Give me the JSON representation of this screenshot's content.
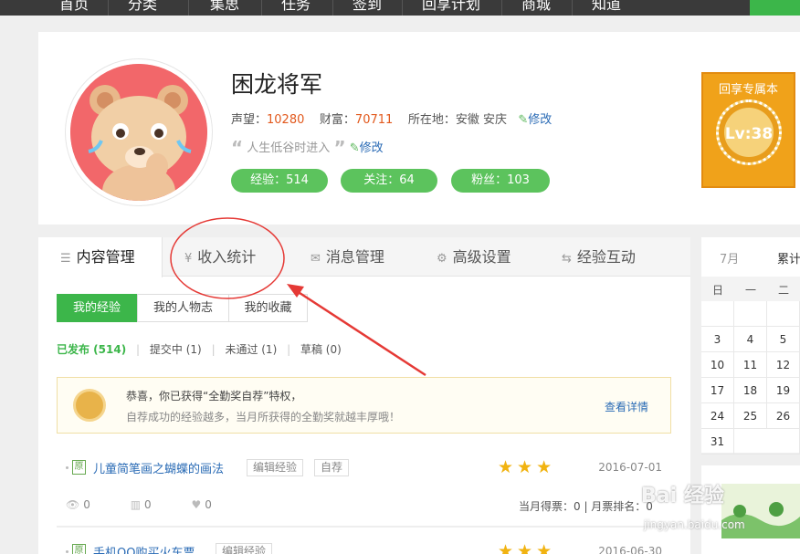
{
  "topnav": {
    "items": [
      "首页",
      "分类",
      "集思",
      "任务",
      "签到",
      "回享计划",
      "商城",
      "知道"
    ]
  },
  "profile": {
    "username": "困龙将军",
    "reputation_label": "声望：",
    "reputation": "10280",
    "wealth_label": "财富：",
    "wealth": "70711",
    "location_label": "所在地：",
    "location": "安徽 安庆",
    "edit_label": "修改",
    "motto": "人生低谷时进入",
    "motto_edit": "修改",
    "experience": "经验：514",
    "follow": "关注：64",
    "fans": "粉丝：103",
    "vip_title": "回享专属本",
    "vip_level": "Lv:38"
  },
  "tabs": [
    {
      "label": "内容管理",
      "icon": "list-icon"
    },
    {
      "label": "收入统计",
      "icon": "yen-icon"
    },
    {
      "label": "消息管理",
      "icon": "mail-icon"
    },
    {
      "label": "高级设置",
      "icon": "gear-icon"
    },
    {
      "label": "经验互动",
      "icon": "swap-icon"
    }
  ],
  "subtabs": [
    "我的经验",
    "我的人物志",
    "我的收藏"
  ],
  "filters": {
    "published": "已发布 (514)",
    "submitted": "提交中 (1)",
    "failed": "未通过 (1)",
    "draft": "草稿 (0)"
  },
  "notice": {
    "line1": "恭喜，你已获得“全勤奖自荐”特权，",
    "line2": "自荐成功的经验越多，当月所获得的全勤奖就越丰厚哦！",
    "link": "查看详情"
  },
  "articles": [
    {
      "badge": "原",
      "title": "儿童简笔画之蝴蝶的画法",
      "tags": [
        "编辑经验",
        "自荐"
      ],
      "stars": 3,
      "date": "2016-07-01",
      "views": "0",
      "votes": "0",
      "likes": "0",
      "monthly": "当月得票：0 | 月票排名：0"
    },
    {
      "badge": "原",
      "title": "手机QQ购买火车票",
      "tags": [
        "编辑经验"
      ],
      "stars": 3,
      "date": "2016-06-30"
    }
  ],
  "calendar": {
    "month": "7月",
    "side": "累计",
    "weekdays": [
      "日",
      "一",
      "二"
    ],
    "rows": [
      [
        "",
        "",
        ""
      ],
      [
        "3",
        "4",
        "5"
      ],
      [
        "10",
        "11",
        "12"
      ],
      [
        "17",
        "18",
        "19"
      ],
      [
        "24",
        "25",
        "26"
      ],
      [
        "31",
        "",
        ""
      ]
    ]
  },
  "watermark": {
    "brand": "Bai 经验",
    "url": "jingyan.baidu.com"
  },
  "colors": {
    "green": "#3cb64a",
    "link": "#2a6bb5",
    "accent": "#e2591d",
    "annotation": "#e53935"
  }
}
